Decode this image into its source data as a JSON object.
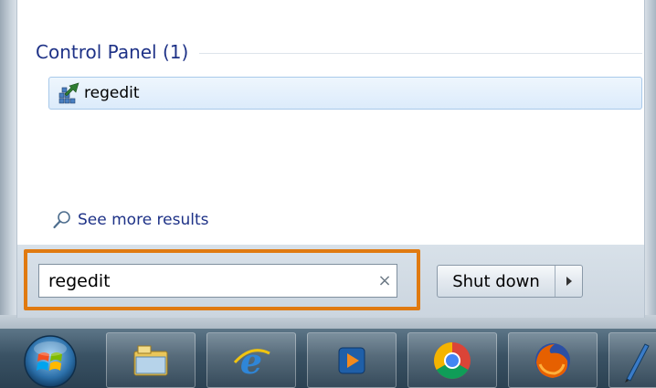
{
  "start_menu": {
    "group_header": "Control Panel (1)",
    "result_label": "regedit",
    "see_more_label": "See more results"
  },
  "search": {
    "value": "regedit",
    "clear_symbol": "×"
  },
  "shutdown": {
    "label": "Shut down",
    "arrow_symbol": "▸"
  },
  "taskbar": {
    "items": [
      "start-orb-icon",
      "file-explorer-icon",
      "internet-explorer-icon",
      "media-player-icon",
      "chrome-icon",
      "firefox-icon",
      "pen-icon"
    ]
  },
  "colors": {
    "highlight": "#e07a10",
    "header_text": "#1e3287",
    "selection": "#dcebfb"
  }
}
